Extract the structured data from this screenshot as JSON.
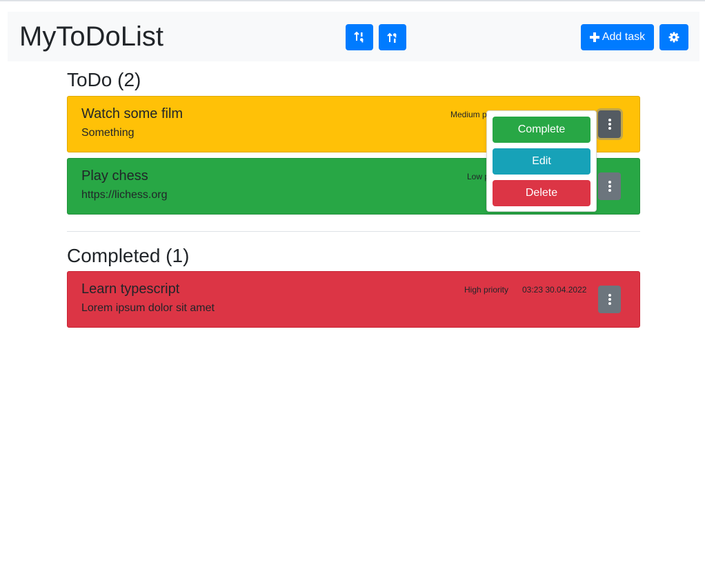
{
  "app": {
    "title": "MyToDoList"
  },
  "toolbar": {
    "sort_asc_icon": "sort-numeric-down-icon",
    "sort_desc_icon": "sort-numeric-up-icon",
    "add_label": "Add task",
    "add_icon": "plus-icon",
    "settings_icon": "gear-icon"
  },
  "sections": {
    "todo": {
      "title": "ToDo (2)"
    },
    "completed": {
      "title": "Completed (1)"
    }
  },
  "tasks": [
    {
      "title": "Watch some film",
      "description": "Something",
      "priority": "Medium priority",
      "color": "#ffc107"
    },
    {
      "title": "Play chess",
      "description": "https://lichess.org",
      "priority": "Low priority",
      "color": "#28a745"
    }
  ],
  "completed_tasks": [
    {
      "title": "Learn typescript",
      "description": "Lorem ipsum dolor sit amet",
      "priority": "High priority",
      "timestamp": "03:23 30.04.2022",
      "color": "#dc3545"
    }
  ],
  "dropdown": {
    "complete_label": "Complete",
    "edit_label": "Edit",
    "delete_label": "Delete"
  },
  "colors": {
    "primary": "#007bff",
    "secondary": "#6c757d",
    "success": "#28a745",
    "info": "#17a2b8",
    "danger": "#dc3545",
    "warning": "#ffc107"
  }
}
